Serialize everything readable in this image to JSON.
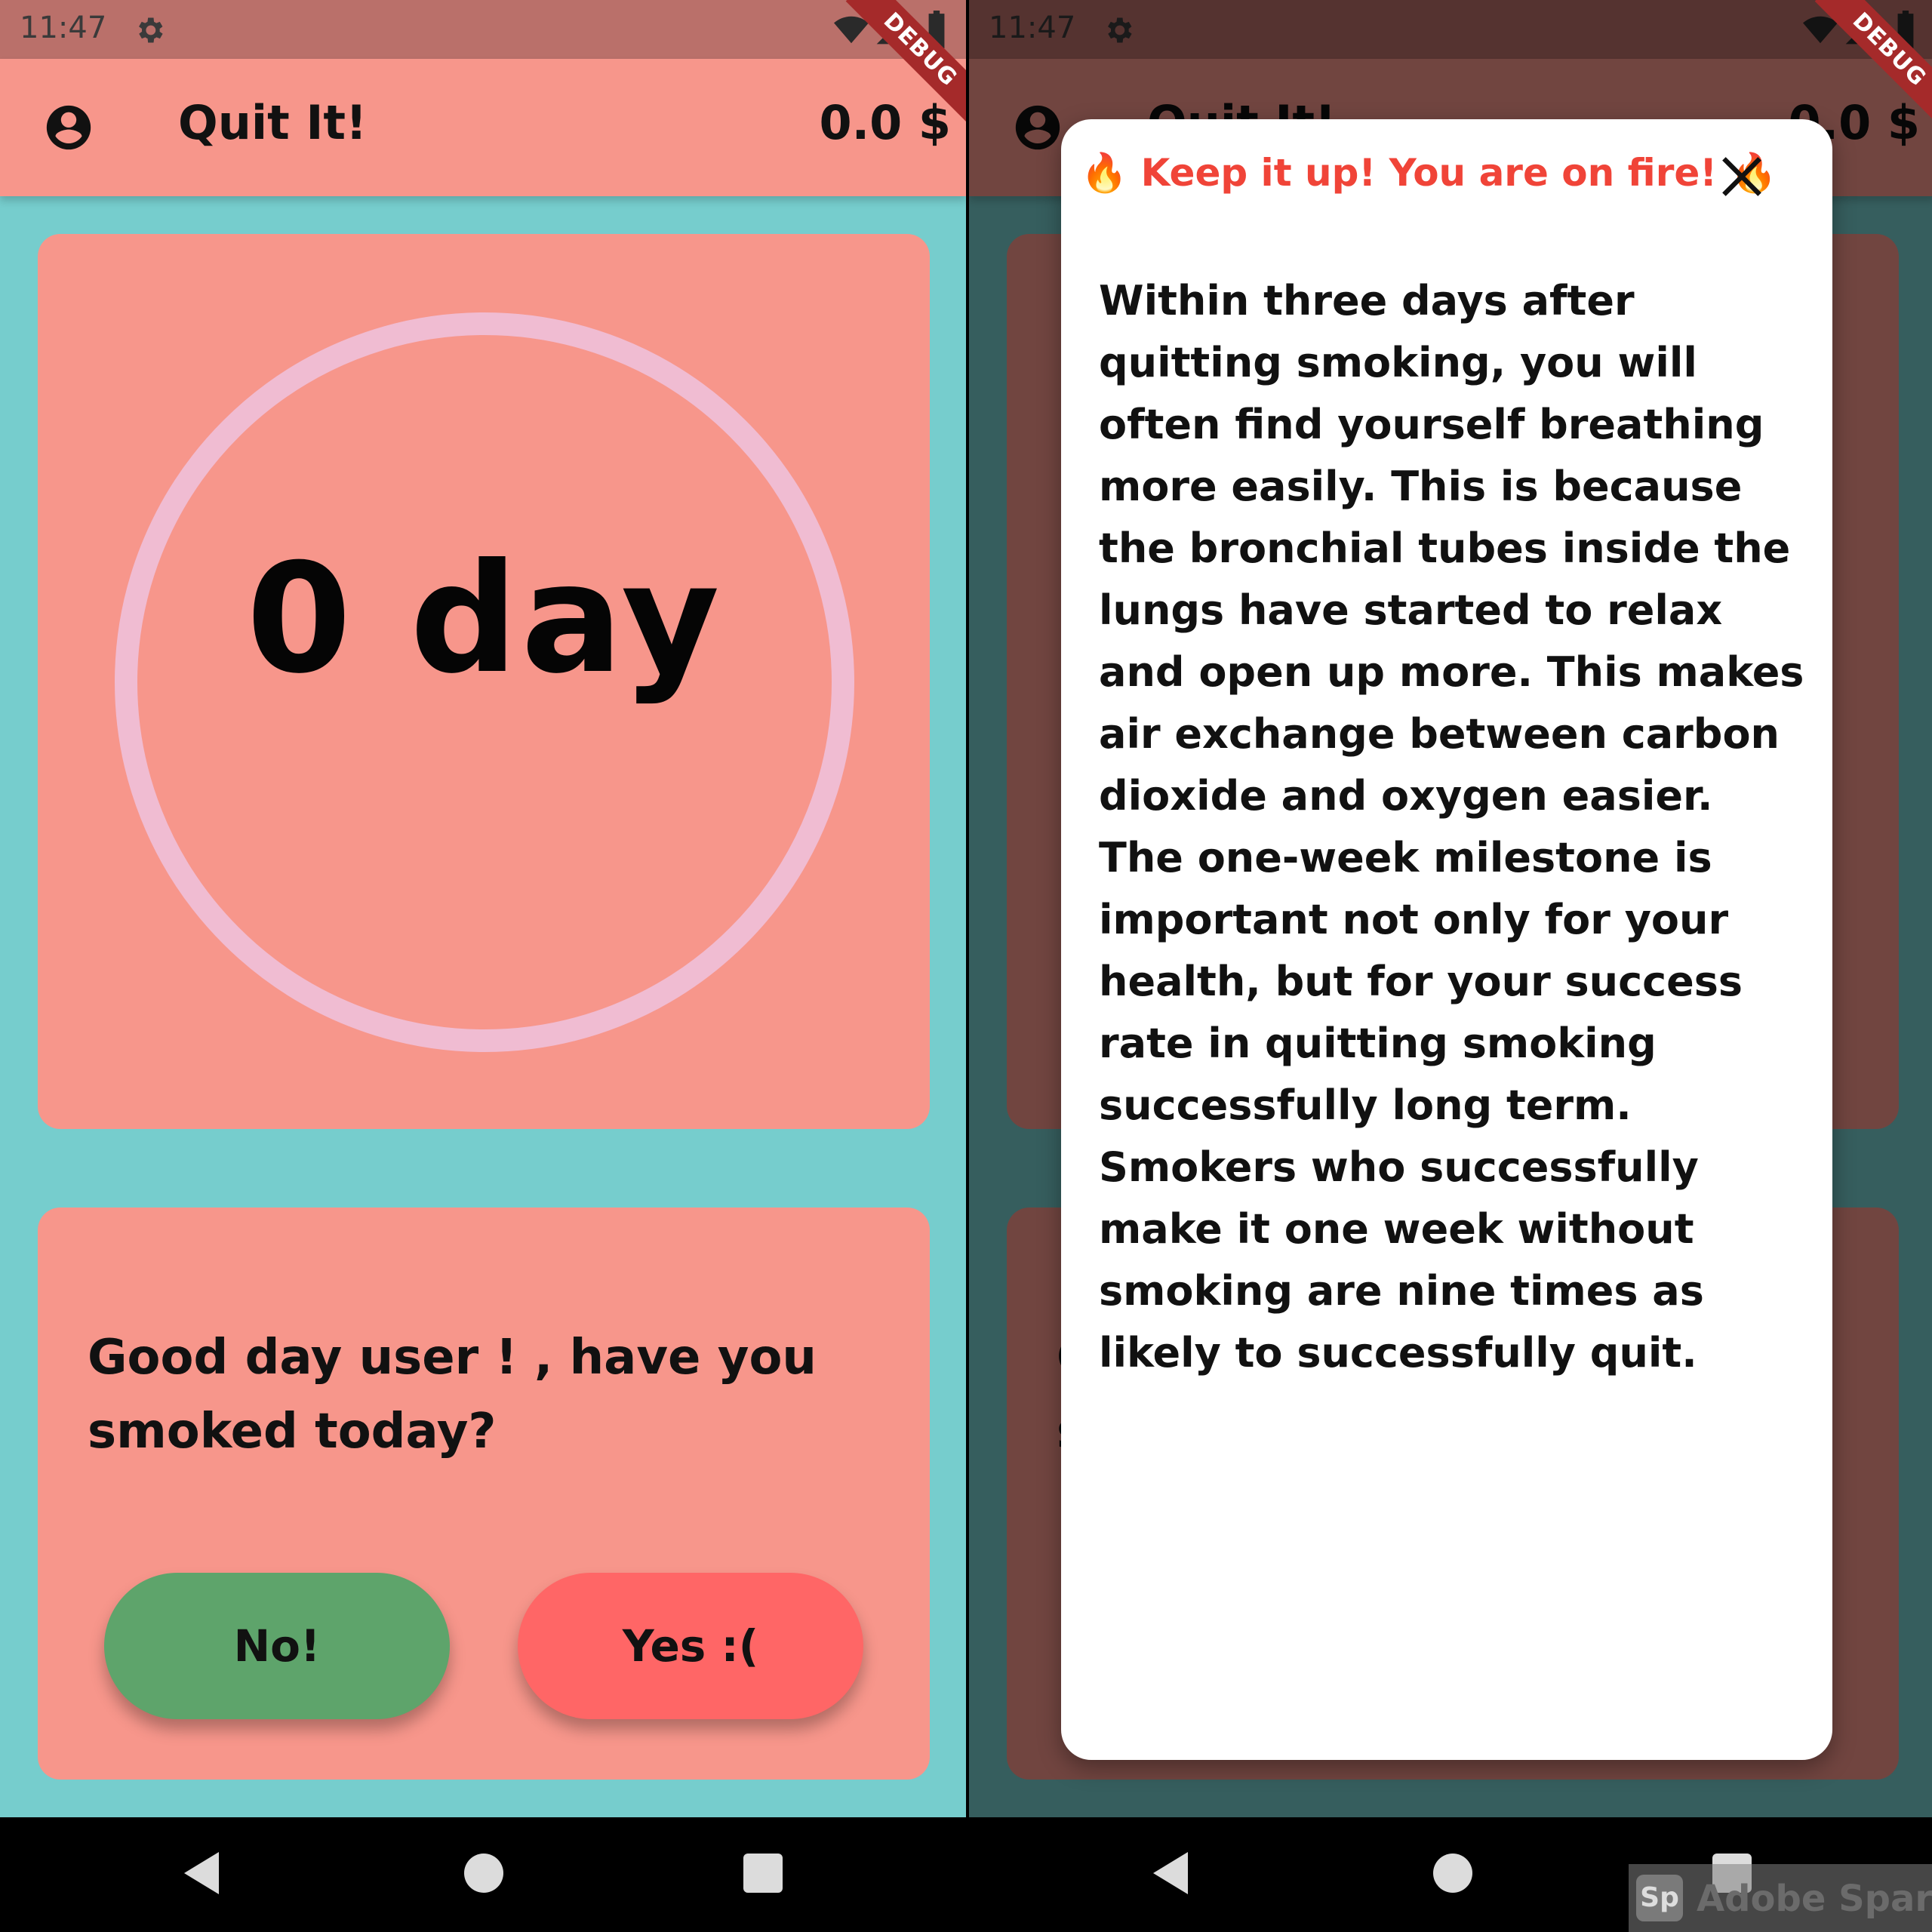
{
  "status_bar": {
    "time": "11:47"
  },
  "debug_banner": "DEBUG",
  "app_bar": {
    "title": "Quit It!",
    "money": "0.0 $"
  },
  "counter": {
    "text": "0 day"
  },
  "prompt": {
    "question": "Good day user ! , have you smoked today?",
    "no_label": "No!",
    "yes_label": "Yes :("
  },
  "dialog": {
    "title": "🔥 Keep it up! You are on fire! 🔥",
    "body": "Within three days after quitting smoking, you will often find yourself breathing more easily. This is because the bronchial tubes inside the lungs have started to relax and open up more. This makes air exchange between carbon dioxide and oxygen easier. The one-week milestone is important not only for your health, but for your success rate in quitting smoking successfully long term. Smokers who successfully make it one week without smoking are nine times as likely to successfully quit."
  },
  "watermark": {
    "logo": "Sp",
    "text": "Adobe Spark"
  },
  "colors": {
    "background": "#76CDCD",
    "card": "#F7968B",
    "no_button": "#5EA46B",
    "yes_button": "#FF6666",
    "dialog_title": "#F04438",
    "ring": "#F0BCD2"
  },
  "icons": [
    "gear-icon",
    "wifi-icon",
    "signal-icon",
    "battery-icon",
    "account-icon",
    "close-icon",
    "back-icon",
    "home-icon",
    "recents-icon"
  ]
}
